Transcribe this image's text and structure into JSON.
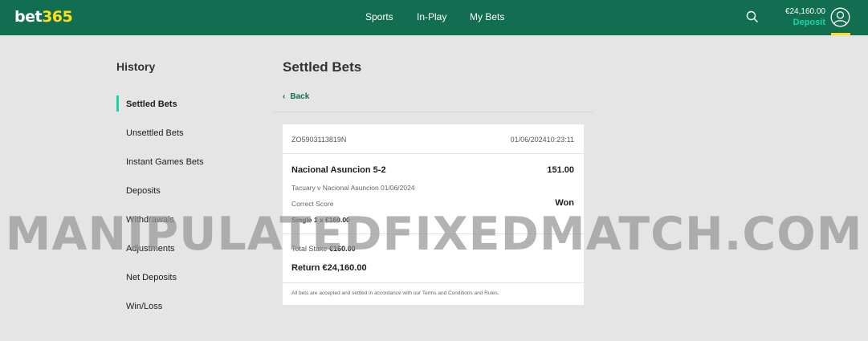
{
  "header": {
    "logo": {
      "part1": "bet",
      "part2": "365"
    },
    "nav": [
      "Sports",
      "In-Play",
      "My Bets"
    ],
    "balance": "€24,160.00",
    "deposit_label": "Deposit"
  },
  "sidebar": {
    "title": "History",
    "items": [
      "Settled Bets",
      "Unsettled Bets",
      "Instant Games Bets",
      "Deposits",
      "Withdrawals",
      "Adjustments",
      "Net Deposits",
      "Win/Loss"
    ],
    "active_index": 0
  },
  "main": {
    "title": "Settled Bets",
    "back_label": "Back",
    "bet": {
      "reference": "ZO5903113819N",
      "datetime": "01/06/202410:23:11",
      "selection": "Nacional Asuncion 5-2",
      "odds": "151.00",
      "event": "Tacuary v Nacional Asuncion 01/06/2024",
      "market": "Correct Score",
      "result": "Won",
      "bet_type": "Single 1 x €160.00",
      "total_stake_label": "Total Stake",
      "total_stake_value": "€160.00",
      "return_label": "Return",
      "return_value": "€24,160.00",
      "terms": "All bets are accepted and settled in accordance with our Terms and Conditions and Rules."
    }
  },
  "watermark": "MANIPULATEDFIXEDMATCH.COM",
  "colors": {
    "header_bg": "#126e51",
    "logo_accent": "#ffdf1b",
    "deposit_text": "#14d6a4",
    "active_bar": "#14d6a4",
    "page_bg": "#e5e5e5"
  }
}
